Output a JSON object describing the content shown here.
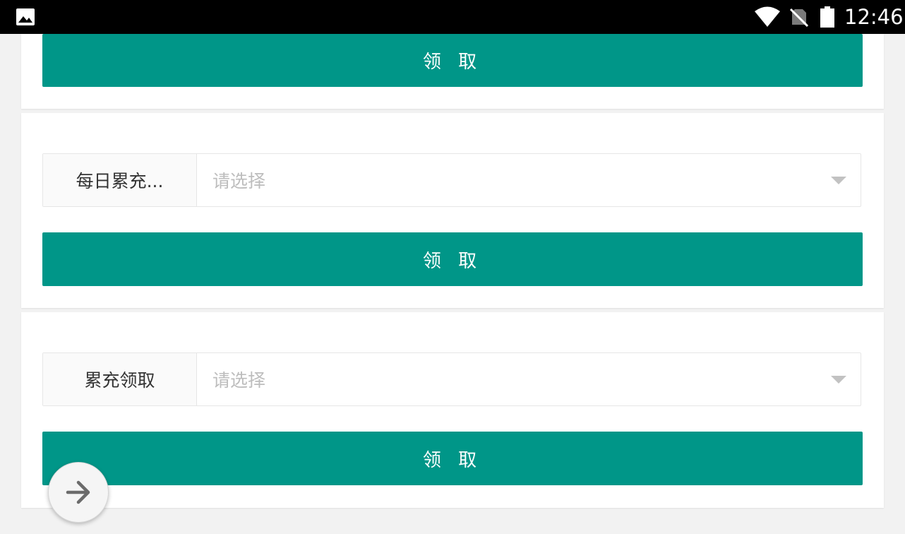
{
  "status_bar": {
    "time": "12:46",
    "icons": [
      "image-icon",
      "wifi-icon",
      "no-sim-icon",
      "battery-icon"
    ]
  },
  "colors": {
    "accent": "#009688",
    "placeholder": "#bdbdbd",
    "background": "#f2f2f2"
  },
  "sections": [
    {
      "button_label": "领 取"
    },
    {
      "select_label": "每日累充...",
      "select_placeholder": "请选择",
      "button_label": "领 取"
    },
    {
      "select_label": "累充领取",
      "select_placeholder": "请选择",
      "button_label": "领 取"
    }
  ],
  "fab": {
    "icon": "arrow-right-icon"
  }
}
